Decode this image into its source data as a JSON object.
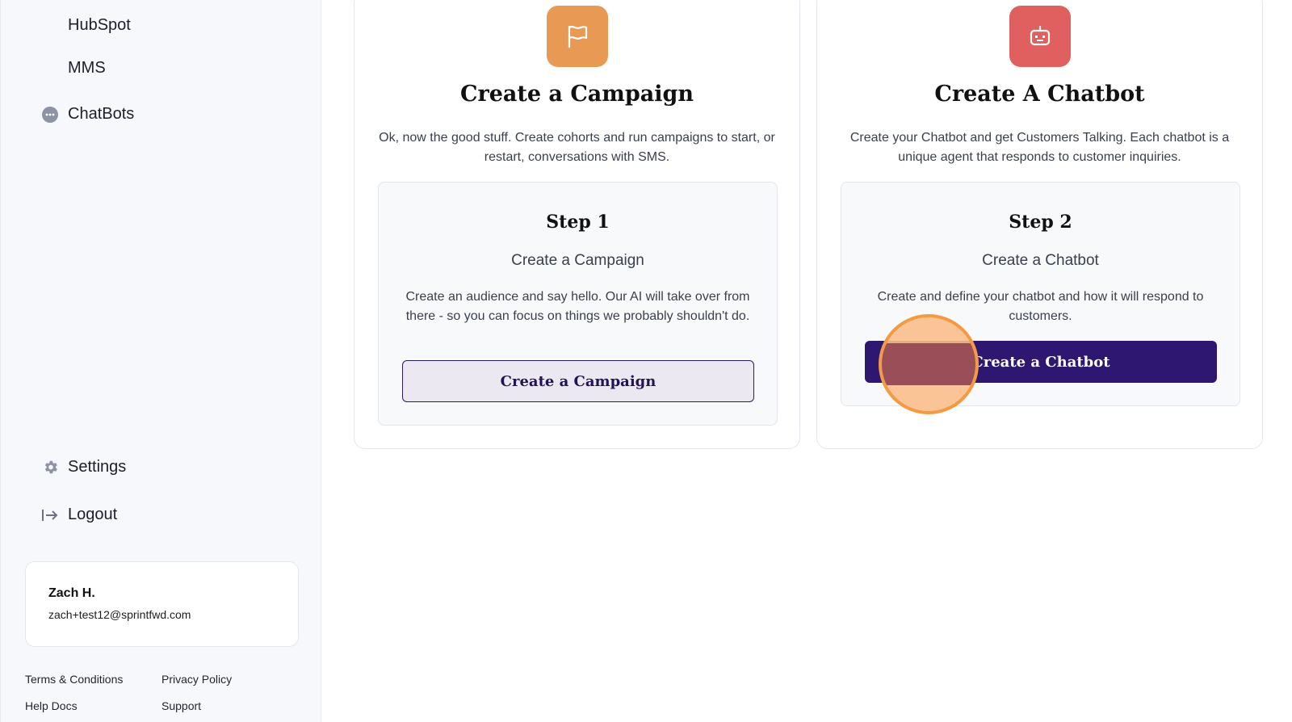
{
  "sidebar": {
    "items": [
      {
        "label": "HubSpot",
        "icon": "none"
      },
      {
        "label": "MMS",
        "icon": "none"
      },
      {
        "label": "ChatBots",
        "icon": "chat-bubble-icon"
      },
      {
        "label": "Settings",
        "icon": "gear-icon"
      },
      {
        "label": "Logout",
        "icon": "logout-icon"
      }
    ],
    "user": {
      "name": "Zach H.",
      "email": "zach+test12@sprintfwd.com"
    },
    "footer": {
      "terms": "Terms & Conditions",
      "privacy": "Privacy Policy",
      "help": "Help Docs",
      "support": "Support"
    }
  },
  "cards": [
    {
      "icon": "flag-icon",
      "icon_color": "#E89A55",
      "title": "Create a Campaign",
      "description": "Ok, now the good stuff. Create cohorts and run campaigns to start, or restart, conversations with SMS.",
      "step": {
        "title": "Step 1",
        "subtitle": "Create a Campaign",
        "description": "Create an audience and say hello. Our AI will take over from there - so you can focus on things we probably shouldn't do.",
        "button": "Create a Campaign"
      }
    },
    {
      "icon": "robot-icon",
      "icon_color": "#E05F5F",
      "title": "Create A Chatbot",
      "description": "Create your Chatbot and get Customers Talking. Each chatbot is a unique agent that responds to customer inquiries.",
      "step": {
        "title": "Step 2",
        "subtitle": "Create a Chatbot",
        "description": "Create and define your chatbot and how it will respond to customers.",
        "button": "Create a Chatbot"
      }
    }
  ],
  "colors": {
    "brand_dark": "#2E1770",
    "click_indicator": "#F39A44"
  }
}
